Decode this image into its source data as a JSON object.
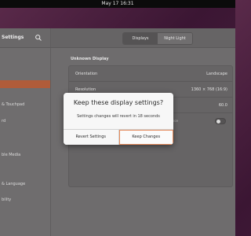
{
  "topbar": {
    "datetime": "May 17  16:31"
  },
  "window": {
    "sidebar_title": "Settings",
    "search_icon": "search-icon",
    "tabs": [
      {
        "label": "Displays",
        "active": true
      },
      {
        "label": "Night Light",
        "active": false
      }
    ]
  },
  "sidebar": {
    "items": [
      {
        "label": "",
        "selected": true
      },
      {
        "label": "& Touchpad",
        "selected": false
      },
      {
        "label": "rd",
        "selected": false
      },
      {
        "label": "ble Media",
        "selected": false
      },
      {
        "label": "& Language",
        "selected": false
      },
      {
        "label": "bility",
        "selected": false
      }
    ]
  },
  "content": {
    "heading": "Unknown Display",
    "rows": {
      "orientation": {
        "label": "Orientation",
        "value": "Landscape"
      },
      "resolution": {
        "label": "Resolution",
        "value": "1360 × 768 (16:9)"
      },
      "refresh": {
        "value": "60.0"
      },
      "fractional": {
        "sub": "formance"
      }
    }
  },
  "dialog": {
    "title": "Keep these display settings?",
    "message": "Settings changes will revert in 18 seconds",
    "revert_label": "Revert Settings",
    "keep_label": "Keep Changes"
  },
  "colors": {
    "accent": "#e95420",
    "selected_sidebar": "#b05c3a"
  }
}
